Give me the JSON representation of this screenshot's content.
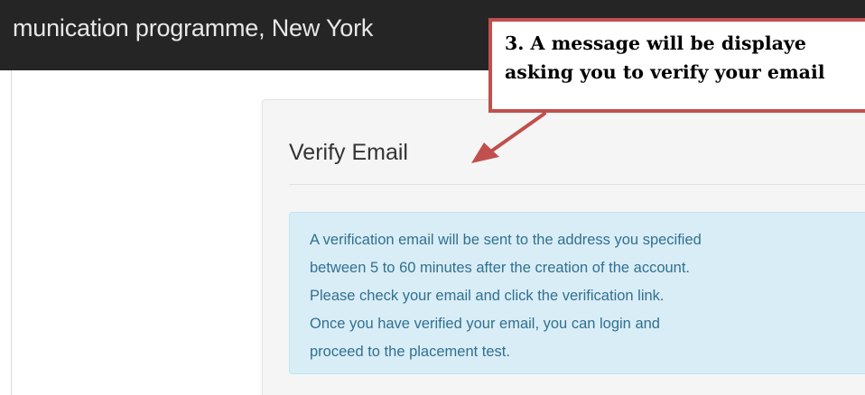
{
  "header": {
    "title": "munication programme, New York"
  },
  "panel": {
    "heading": "Verify Email",
    "message_lines": [
      "A verification email will be sent to the address you specified",
      "between 5 to 60 minutes after the creation of the account.",
      "Please check your email and click the verification link.",
      "Once you have verified your email, you can login and",
      "proceed to the placement test."
    ]
  },
  "callout": {
    "lines": [
      "3. A message will be displaye",
      "asking you to verify your email"
    ],
    "border_color": "#c0504d"
  },
  "colors": {
    "topbar": "#252525",
    "alert_background": "#d9edf7",
    "alert_text": "#31708f",
    "arrow": "#c0504d"
  }
}
